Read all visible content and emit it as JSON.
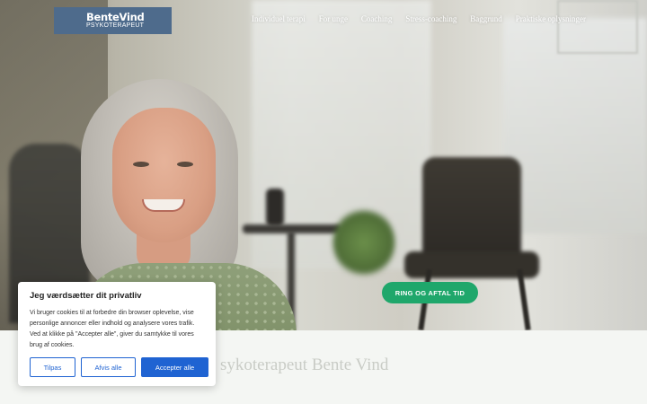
{
  "header": {
    "logo": {
      "name": "BenteVind",
      "subtitle": "PSYKOTERAPEUT"
    },
    "nav": [
      {
        "label": "Individuel terapi"
      },
      {
        "label": "For unge"
      },
      {
        "label": "Coaching"
      },
      {
        "label": "Stress-coaching"
      },
      {
        "label": "Baggrund"
      },
      {
        "label": "Praktiske oplysninger"
      }
    ]
  },
  "hero": {
    "cta_label": "RING OG AFTAL TID"
  },
  "below": {
    "title_fragment": "sykoterapeut Bente Vind"
  },
  "cookie_banner": {
    "title": "Jeg værdsætter dit privatliv",
    "body": "Vi bruger cookies til at forbedre din browser oplevelse, vise personlige annoncer eller indhold og analysere vores trafik. Ved at klikke på \"Accepter alle\", giver du samtykke til vores brug af cookies.",
    "buttons": {
      "customize": "Tilpas",
      "reject": "Afvis alle",
      "accept": "Accepter alle"
    }
  },
  "colors": {
    "logo_bg": "#4e6b8c",
    "cta_green": "#1fa76b",
    "cookie_blue": "#1f63d2"
  }
}
